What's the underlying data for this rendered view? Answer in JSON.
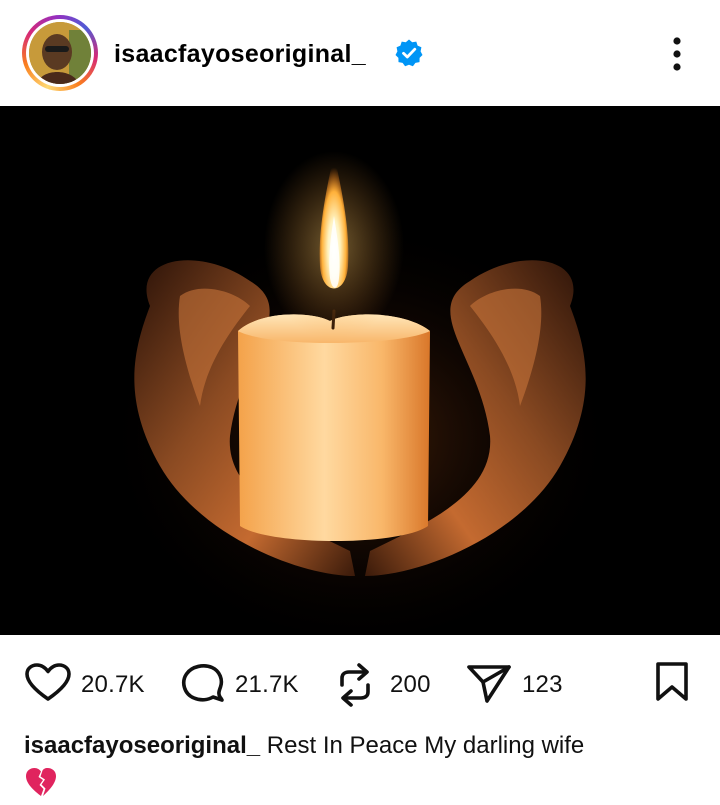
{
  "post": {
    "username": "isaacfayoseoriginal_",
    "verified": true,
    "caption_text": "Rest In Peace My darling wife",
    "caption_emoji": "broken-heart"
  },
  "actions": {
    "likes": "20.7K",
    "comments": "21.7K",
    "reposts": "200",
    "shares": "123"
  },
  "icons": {
    "like": "heart-icon",
    "comment": "comment-icon",
    "repost": "repost-icon",
    "share": "send-icon",
    "save": "bookmark-icon",
    "more": "more-vertical-icon",
    "verified": "verified-badge-icon"
  },
  "colors": {
    "verified_blue": "#0095f6",
    "background": "#ffffff",
    "text": "#111111",
    "broken_heart": "#e0245e"
  }
}
